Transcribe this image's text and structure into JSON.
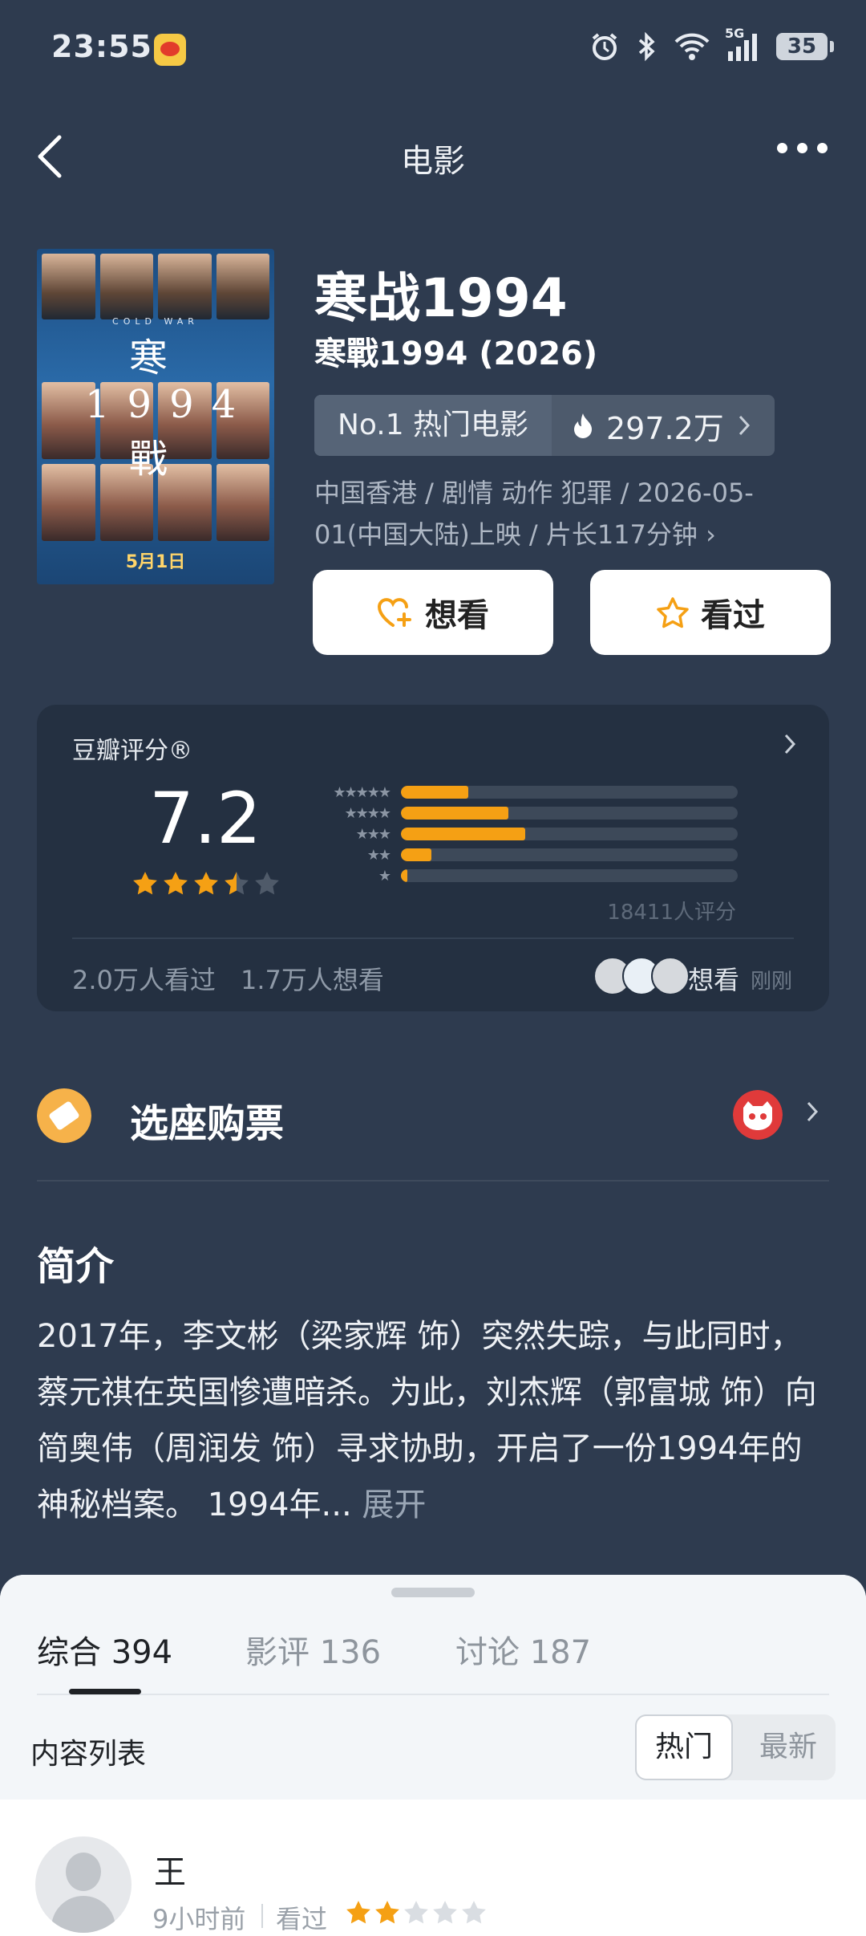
{
  "status_bar": {
    "time": "23:55",
    "network": "5G",
    "battery": "35"
  },
  "nav": {
    "title": "电影"
  },
  "poster": {
    "en_title": "COLD WAR",
    "title": "寒1994戰",
    "date": "5月1日"
  },
  "movie": {
    "title": "寒战1994",
    "subtitle": "寒戰1994 (2026)",
    "rank_label": "No.1 热门电影",
    "heat": "297.2万",
    "meta": "中国香港 / 剧情 动作 犯罪 / 2026-05-01(中国大陆)上映 / 片长117分钟 ›"
  },
  "actions": {
    "want_label": "想看",
    "watched_label": "看过"
  },
  "rating": {
    "label": "豆瓣评分®",
    "score": "7.2",
    "stars": 3.5,
    "distribution": [
      {
        "stars": "★★★★★",
        "fraction": 0.2
      },
      {
        "stars": "★★★★",
        "fraction": 0.32
      },
      {
        "stars": "★★★",
        "fraction": 0.37
      },
      {
        "stars": "★★",
        "fraction": 0.09
      },
      {
        "stars": "★",
        "fraction": 0.02
      }
    ],
    "count_text": "18411人评分",
    "watched_text": "2.0万人看过",
    "want_text": "1.7万人想看",
    "friend_action": "想看",
    "friend_time": "刚刚"
  },
  "ticket": {
    "label": "选座购票"
  },
  "intro": {
    "title": "简介",
    "text": "2017年，李文彬（梁家辉 饰）突然失踪，与此同时，蔡元祺在英国惨遭暗杀。为此，刘杰辉（郭富城 饰）向简奥伟（周润发 饰）寻求协助，开启了一份1994年的神秘档案。 1994年...",
    "more": "展开"
  },
  "tabs": [
    {
      "label": "综合",
      "count": "394"
    },
    {
      "label": "影评",
      "count": "136"
    },
    {
      "label": "讨论",
      "count": "187"
    }
  ],
  "content_list": {
    "label": "内容列表",
    "sort_hot": "热门",
    "sort_new": "最新"
  },
  "review": {
    "user": "王",
    "time": "9小时前",
    "status": "看过",
    "stars": 2
  },
  "colors": {
    "accent": "#f5a014",
    "background": "#2e3b4f",
    "card": "#243041"
  }
}
